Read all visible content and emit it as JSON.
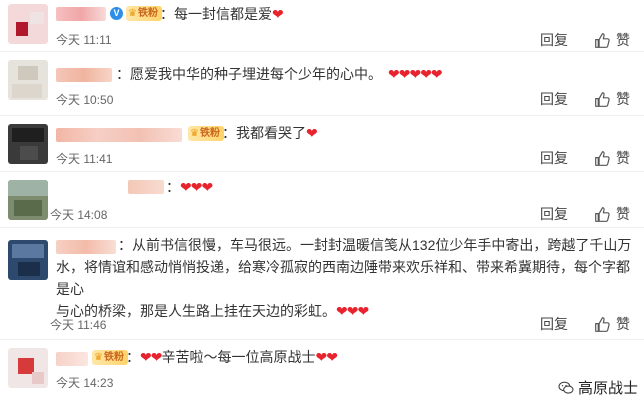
{
  "fan_badge": "铁粉",
  "reply_label": "回复",
  "like_label": "赞",
  "comments": [
    {
      "text": "每一封信都是爱",
      "hearts": "❤",
      "time": "",
      "time_visible": "今天 11:11"
    },
    {
      "text": "愿爱我中华的种子埋进每个少年的心中。",
      "hearts": "❤❤❤❤❤",
      "time_visible": "今天 10:50"
    },
    {
      "text": "我都看哭了",
      "hearts": "❤",
      "time_visible": "今天 11:41"
    },
    {
      "text": "",
      "hearts": "❤❤❤",
      "time_visible": "今天 14:08"
    },
    {
      "text_line1": "从前书信很慢，车马很远。一封封温暖信笺从132位少年手中寄出，跨越了千山万",
      "text_line2": "水，将情谊和感动悄悄投递，给寒冷孤寂的西南边陲带来欢乐祥和、带来希冀期待，每个字都是心",
      "text_line3": "与心的桥梁，那是人生路上挂在天边的彩虹。",
      "hearts": "❤❤❤",
      "time_visible": "今天 11:46"
    },
    {
      "text_pre": "",
      "hearts_pre": "❤❤",
      "text": "辛苦啦～每一位高原战士",
      "hearts": "❤❤",
      "time_visible": "今天 14:23"
    }
  ],
  "watermark": {
    "text": "高原战士",
    "icon": "wechat-icon"
  },
  "colors": {
    "heart": "#e8232d",
    "badge_bg": "#ffd36a",
    "badge_text": "#c8651c",
    "verified": "#2d8ee8"
  }
}
